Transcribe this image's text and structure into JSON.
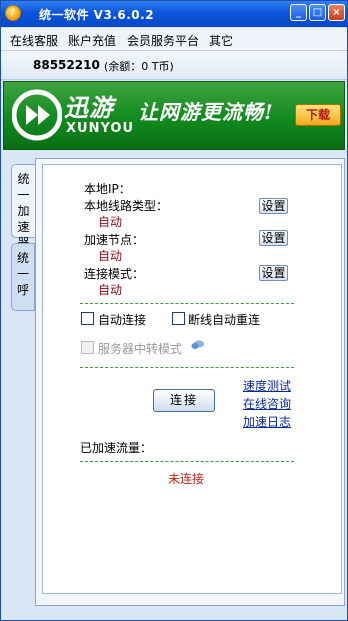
{
  "window": {
    "title": "统一软件 V3.6.0.2",
    "buttons": {
      "minimize": "_",
      "maximize": "□",
      "close": "×"
    }
  },
  "menu": {
    "items": [
      "在线客服",
      "账户充值",
      "会员服务平台",
      "其它"
    ]
  },
  "account": {
    "id": "88552210",
    "balance": "(余额：0 T币)"
  },
  "banner": {
    "logo_cn": "迅游",
    "logo_en": "XUNYOU",
    "slogan": "让网游更流畅!",
    "download_label": "下载",
    "colors": {
      "green": "#118a1f",
      "button": "#f4a91c"
    }
  },
  "tabs": {
    "active": "统一加速器",
    "inactive": "统一呼"
  },
  "main": {
    "local_ip_label": "本地IP：",
    "line_type_label": "本地线路类型：",
    "line_type_value": "自动",
    "node_label": "加速节点：",
    "node_value": "自动",
    "mode_label": "连接模式：",
    "mode_value": "自动",
    "setting_label": "设置",
    "auto_connect_label": "自动连接",
    "auto_reconnect_label": "断线自动重连",
    "relay_mode_label": "服务器中转模式",
    "connect_label": "连接",
    "links": [
      "速度测试",
      "在线咨询",
      "加速日志"
    ],
    "traffic_label": "已加速流量：",
    "status": "未连接"
  }
}
